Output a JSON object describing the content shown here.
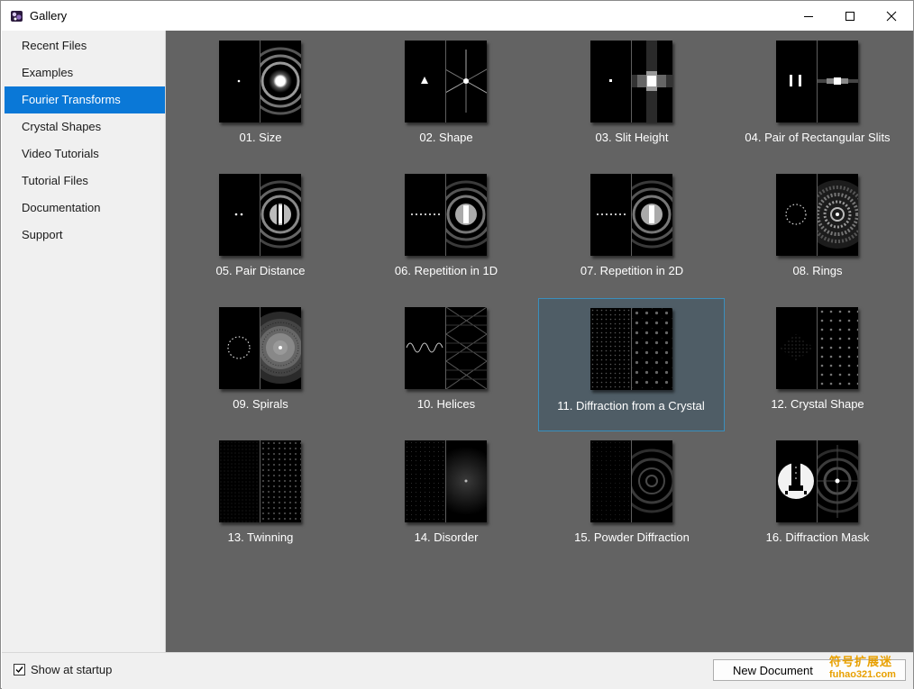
{
  "window": {
    "title": "Gallery",
    "app_icon": "app-logo-icon"
  },
  "window_buttons": [
    "minimize-icon",
    "maximize-icon",
    "close-icon"
  ],
  "sidebar": {
    "items": [
      {
        "label": "Recent Files",
        "active": false
      },
      {
        "label": "Examples",
        "active": false
      },
      {
        "label": "Fourier Transforms",
        "active": true
      },
      {
        "label": "Crystal Shapes",
        "active": false
      },
      {
        "label": "Video Tutorials",
        "active": false
      },
      {
        "label": "Tutorial Files",
        "active": false
      },
      {
        "label": "Documentation",
        "active": false
      },
      {
        "label": "Support",
        "active": false
      }
    ],
    "active_color": "#0a78d7"
  },
  "gallery": {
    "background": "#636363",
    "selected_index": 10,
    "items": [
      {
        "label": "01. Size"
      },
      {
        "label": "02. Shape"
      },
      {
        "label": "03. Slit Height"
      },
      {
        "label": "04. Pair of Rectangular Slits"
      },
      {
        "label": "05. Pair Distance"
      },
      {
        "label": "06. Repetition in 1D"
      },
      {
        "label": "07. Repetition in 2D"
      },
      {
        "label": "08. Rings"
      },
      {
        "label": "09. Spirals"
      },
      {
        "label": "10. Helices"
      },
      {
        "label": "11. Diffraction from a Crystal"
      },
      {
        "label": "12. Crystal Shape"
      },
      {
        "label": "13. Twinning"
      },
      {
        "label": "14. Disorder"
      },
      {
        "label": "15. Powder Diffraction"
      },
      {
        "label": "16. Diffraction Mask"
      }
    ]
  },
  "footer": {
    "show_at_startup_label": "Show at startup",
    "show_at_startup_checked": true,
    "new_document_label": "New Document",
    "watermark_line1": "符号扩展迷",
    "watermark_line2": "fuhao321.com"
  }
}
